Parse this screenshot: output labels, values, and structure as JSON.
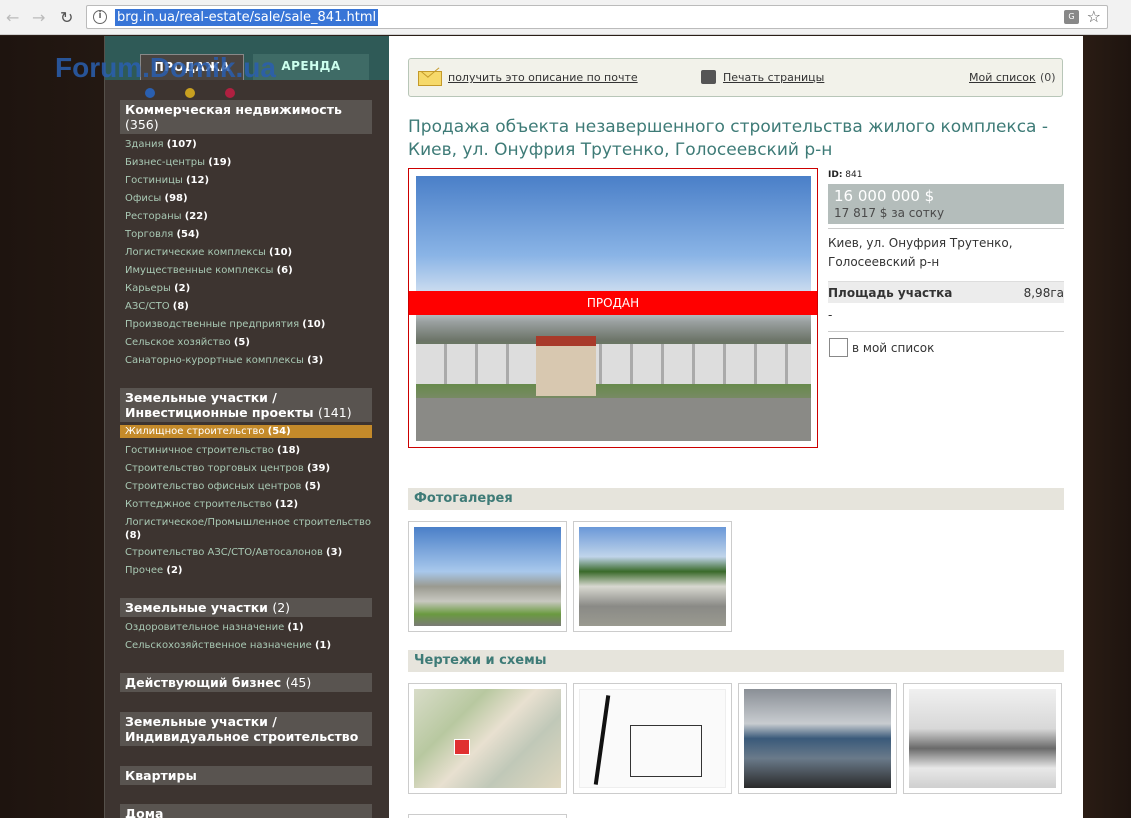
{
  "browser": {
    "url": "brg.in.ua/real-estate/sale/sale_841.html"
  },
  "sidebar": {
    "watermark": "Forum.Domik.ua",
    "tabs": [
      "ПРОДАЖА",
      "АРЕНДА"
    ],
    "categories": [
      {
        "title": "Коммерческая недвижимость",
        "count": "(356)",
        "items": [
          {
            "label": "Здания",
            "count": "(107)"
          },
          {
            "label": "Бизнес-центры",
            "count": "(19)"
          },
          {
            "label": "Гостиницы",
            "count": "(12)"
          },
          {
            "label": "Офисы",
            "count": "(98)"
          },
          {
            "label": "Рестораны",
            "count": "(22)"
          },
          {
            "label": "Торговля",
            "count": "(54)"
          },
          {
            "label": "Логистические комплексы",
            "count": "(10)"
          },
          {
            "label": "Имущественные комплексы",
            "count": "(6)"
          },
          {
            "label": "Карьеры",
            "count": "(2)"
          },
          {
            "label": "АЗС/СТО",
            "count": "(8)"
          },
          {
            "label": "Производственные предприятия",
            "count": "(10)"
          },
          {
            "label": "Сельское хозяйство",
            "count": "(5)"
          },
          {
            "label": "Санаторно-курортные комплексы",
            "count": "(3)"
          }
        ]
      },
      {
        "title_line1": "Земельные участки /",
        "title_line2": "Инвестиционные проекты",
        "count": "(141)",
        "items": [
          {
            "label": "Жилищное строительство",
            "count": "(54)"
          },
          {
            "label": "Гостиничное строительство",
            "count": "(18)"
          },
          {
            "label": "Строительство торговых центров",
            "count": "(39)"
          },
          {
            "label": "Строительство офисных центров",
            "count": "(5)"
          },
          {
            "label": "Коттеджное строительство",
            "count": "(12)"
          },
          {
            "label": "Логистическое/Промышленное строительство",
            "count": "(8)"
          },
          {
            "label": "Строительство АЗС/СТО/Автосалонов",
            "count": "(3)"
          },
          {
            "label": "Прочее",
            "count": "(2)"
          }
        ]
      },
      {
        "title": "Земельные участки",
        "count": "(2)",
        "items": [
          {
            "label": "Оздоровительное назначение",
            "count": "(1)"
          },
          {
            "label": "Сельскохозяйственное назначение",
            "count": "(1)"
          }
        ]
      },
      {
        "title": "Действующий бизнес",
        "count": "(45)"
      },
      {
        "title_line1": "Земельные участки /",
        "title_line2": "Индивидуальное строительство"
      },
      {
        "title": "Квартиры"
      },
      {
        "title": "Дома"
      }
    ]
  },
  "toolbar": {
    "mail_link": "получить это описание по почте",
    "print_link": "Печать страницы",
    "list_link": "Мой список",
    "list_count": "(0)"
  },
  "listing": {
    "title": "Продажа объекта незавершенного строительства жилого комплекса - Киев, ул. Онуфрия Трутенко, Голосеевский р-н",
    "sold_label": "ПРОДАН",
    "id_label": "ID:",
    "id_value": "841",
    "price": "16 000 000 $",
    "price_per": "17 817 $ за сотку",
    "address": "Киев, ул. Онуфрия Трутенко, Голосеевский р-н",
    "area_label": "Площадь участка",
    "area_value": "8,98га",
    "dash": "-",
    "mylist_label": "в мой список"
  },
  "sections": {
    "gallery": "Фотогалерея",
    "drawings": "Чертежи и схемы"
  }
}
